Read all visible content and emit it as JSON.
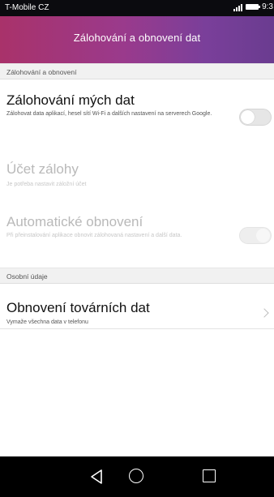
{
  "status_bar": {
    "carrier": "T-Mobile CZ",
    "time": "9:3"
  },
  "header": {
    "title": "Zálohování a obnovení dat"
  },
  "sections": {
    "backup": {
      "header": "Zálohování a obnovení",
      "backup_my_data": {
        "title": "Zálohování mých dat",
        "subtitle": "Zálohovat data aplikací, hesel sítí Wi-Fi a dalších nastavení na serverech Google.",
        "enabled": false
      },
      "backup_account": {
        "title": "Účet zálohy",
        "subtitle": "Je potřeba nastavit záložní účet"
      },
      "auto_restore": {
        "title": "Automatické obnovení",
        "subtitle": "Při přeinstalování aplikace obnovit zálohovaná nastavení a další data.",
        "enabled": true
      }
    },
    "personal": {
      "header": "Osobní údaje",
      "factory_reset": {
        "title": "Obnovení továrních dat",
        "subtitle": "Vymaže všechna data v telefonu"
      }
    }
  },
  "icons": {
    "signal": "signal-icon",
    "battery": "battery-icon",
    "chevron": "chevron-right-icon",
    "back": "back-triangle-icon",
    "home": "home-circle-icon",
    "recent": "recent-apps-icon"
  },
  "colors": {
    "header_gradient_start": "#a9326a",
    "header_gradient_end": "#6a3c90",
    "status_bar": "#0b0b0f",
    "nav_bar": "#000000"
  }
}
